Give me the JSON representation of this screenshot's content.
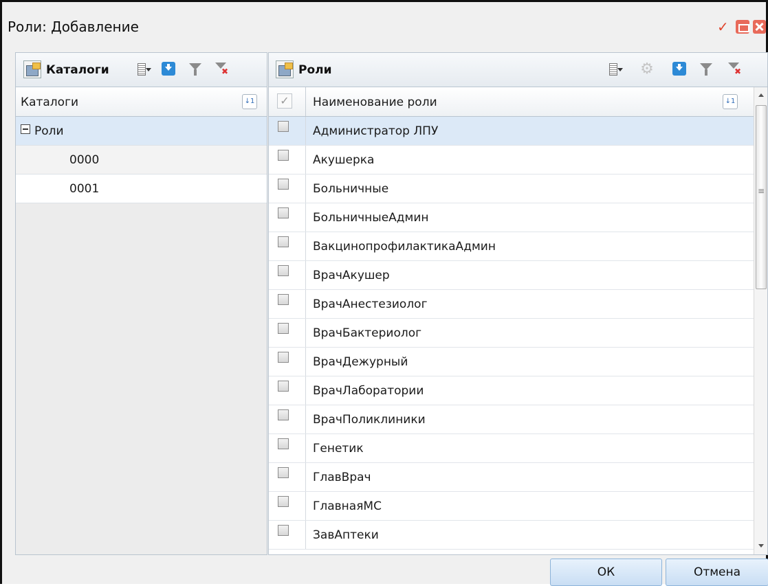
{
  "window": {
    "title": "Роли: Добавление"
  },
  "left_panel": {
    "title": "Каталоги",
    "column_header": "Каталоги",
    "tree": {
      "root": "Роли",
      "children": [
        "0000",
        "0001"
      ]
    }
  },
  "right_panel": {
    "title": "Роли",
    "column_header": "Наименование роли",
    "rows": [
      "Администратор ЛПУ",
      "Акушерка",
      "Больничные",
      "БольничныеАдмин",
      "ВакцинопрофилактикаАдмин",
      "ВрачАкушер",
      "ВрачАнестезиолог",
      "ВрачБактериолог",
      "ВрачДежурный",
      "ВрачЛаборатории",
      "ВрачПоликлиники",
      "Генетик",
      "ГлавВрач",
      "ГлавнаяМС",
      "ЗавАптеки"
    ],
    "selected_index": 0
  },
  "footer": {
    "ok_label": "ОК",
    "cancel_label": "Отмена"
  },
  "icons": {
    "check": "check-icon",
    "minimize": "minimize-icon",
    "close": "close-icon",
    "catalog": "catalog-icon",
    "columns": "columns-menu-icon",
    "download": "download-icon",
    "filter": "filter-icon",
    "filter_clear": "filter-clear-icon",
    "settings": "gear-icon",
    "sort": "sort-icon"
  },
  "colors": {
    "selection": "#dce9f7",
    "button_border": "#8cb3d9",
    "accent_blue": "#2d8ad6",
    "window_red": "#e86a5a"
  }
}
